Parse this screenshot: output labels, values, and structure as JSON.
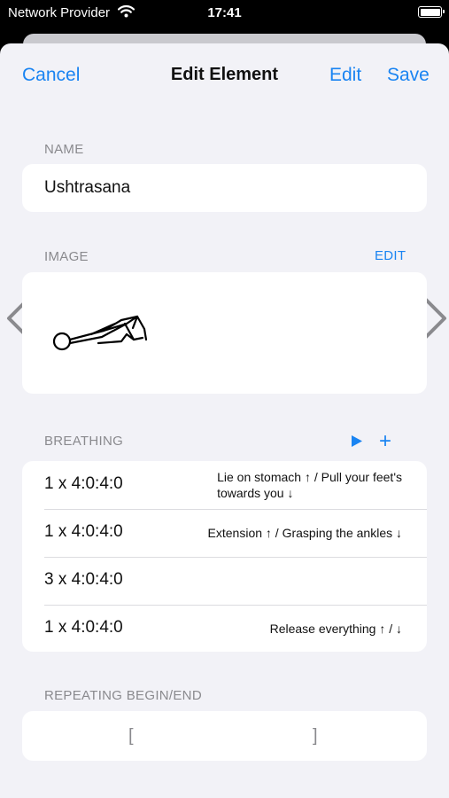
{
  "status_bar": {
    "carrier": "Network Provider",
    "time": "17:41"
  },
  "nav": {
    "cancel_label": "Cancel",
    "title": "Edit Element",
    "edit_label": "Edit",
    "save_label": "Save"
  },
  "name_section": {
    "header": "NAME",
    "value": "Ushtrasana"
  },
  "image_section": {
    "header": "IMAGE",
    "edit_label": "EDIT",
    "prev_icon": "chevron-left-icon",
    "next_icon": "chevron-right-icon"
  },
  "breathing_section": {
    "header": "BREATHING",
    "play_icon": "play-icon",
    "add_label": "+",
    "rows": [
      {
        "count": "1 x 4:0:4:0",
        "description_lines": [
          "Lie on stomach ↑ / Pull your feet's",
          "towards you ↓"
        ]
      },
      {
        "count": "1 x 4:0:4:0",
        "description_lines": [
          "Extension ↑ / Grasping the ankles ↓"
        ]
      },
      {
        "count": "3 x 4:0:4:0",
        "description_lines": []
      },
      {
        "count": "1 x 4:0:4:0",
        "description_lines": [
          "Release everything ↑ / ↓"
        ]
      }
    ]
  },
  "repeating_section": {
    "header": "REPEATING BEGIN/END",
    "begin_bracket": "[",
    "end_bracket": "]"
  },
  "colors": {
    "accent": "#1a84f2",
    "background": "#f2f2f7",
    "card": "#ffffff",
    "secondary_text": "#8a8a8e"
  }
}
